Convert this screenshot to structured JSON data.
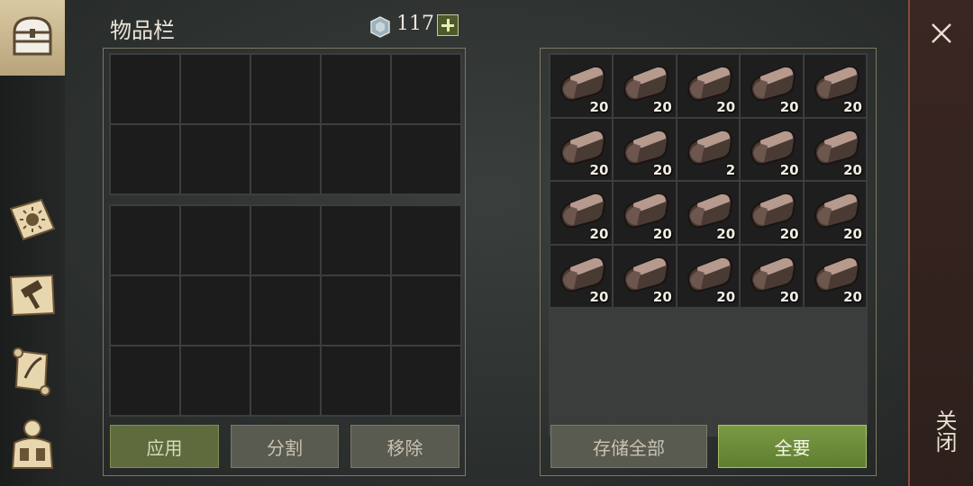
{
  "header": {
    "title": "物品栏",
    "currency_amount": "117"
  },
  "nav": {
    "items": [
      "chest-icon",
      "sun-journal-icon",
      "hammer-map-icon",
      "scroll-icon",
      "character-icon"
    ]
  },
  "left_buttons": {
    "apply": "应用",
    "split": "分割",
    "remove": "移除"
  },
  "right_buttons": {
    "store_all": "存储全部",
    "take_all": "全要"
  },
  "close": {
    "label": "关闭"
  },
  "storage": {
    "item": "iron-ingot-icon",
    "quantities": [
      "20",
      "20",
      "20",
      "20",
      "20",
      "20",
      "20",
      "2",
      "20",
      "20",
      "20",
      "20",
      "20",
      "20",
      "20",
      "20",
      "20",
      "20",
      "20",
      "20"
    ]
  },
  "colors": {
    "accent_green": "#6f8e3b",
    "close_border": "#8a4a3a"
  }
}
